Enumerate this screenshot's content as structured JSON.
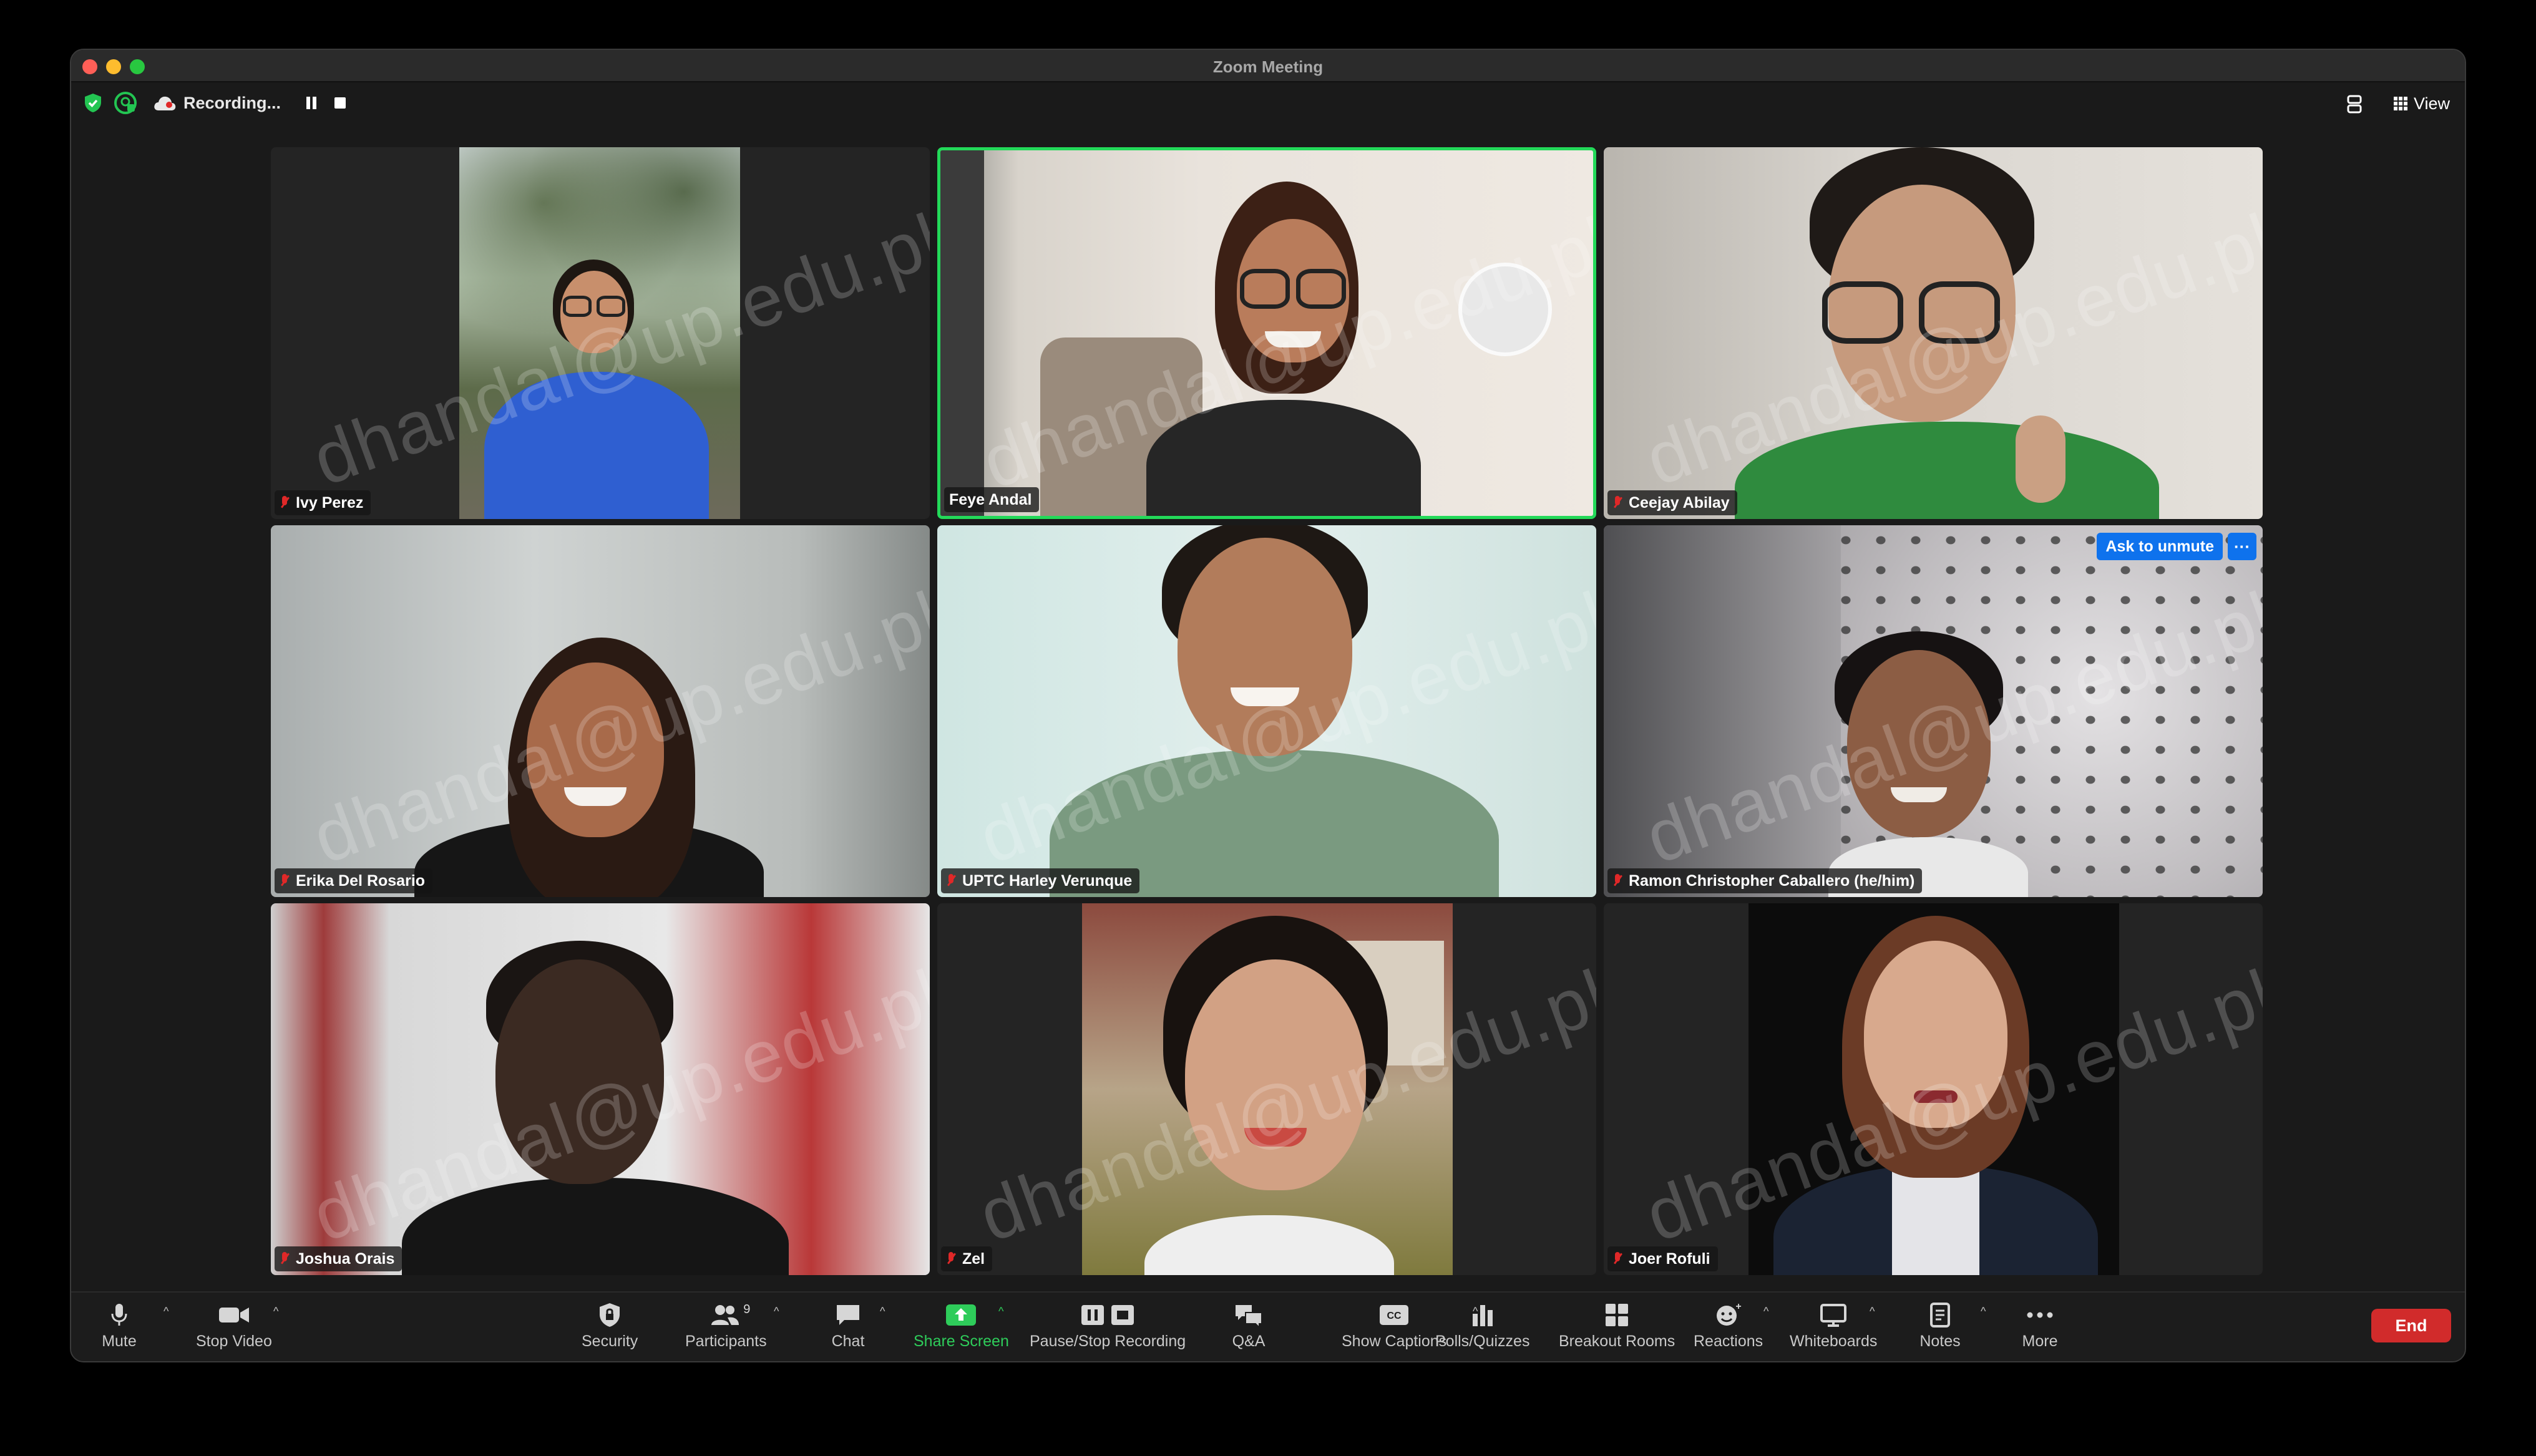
{
  "window": {
    "title": "Zoom Meeting"
  },
  "topbar": {
    "recording_label": "Recording...",
    "view_label": "View"
  },
  "participants": [
    {
      "name": "Ivy Perez",
      "muted": true
    },
    {
      "name": "Feye Andal",
      "muted": false,
      "active_speaker": true
    },
    {
      "name": "Ceejay Abilay",
      "muted": true
    },
    {
      "name": "Erika Del Rosario",
      "muted": true
    },
    {
      "name": "UPTC Harley Verunque",
      "muted": true
    },
    {
      "name": "Ramon Christopher Caballero (he/him)",
      "muted": true
    },
    {
      "name": "Joshua Orais",
      "muted": true
    },
    {
      "name": "Zel",
      "muted": true
    },
    {
      "name": "Joer Rofuli",
      "muted": true
    }
  ],
  "watermark": "dhandal@up.edu.ph",
  "tile_actions": {
    "ask_to_unmute": "Ask to unmute",
    "more": "···"
  },
  "toolbar": {
    "mute": "Mute",
    "stop_video": "Stop Video",
    "security": "Security",
    "participants": "Participants",
    "participants_count": "9",
    "chat": "Chat",
    "share_screen": "Share Screen",
    "pause_stop_recording": "Pause/Stop Recording",
    "qa": "Q&A",
    "show_captions": "Show Captions",
    "polls_quizzes": "Polls/Quizzes",
    "breakout_rooms": "Breakout Rooms",
    "reactions": "Reactions",
    "whiteboards": "Whiteboards",
    "notes": "Notes",
    "more": "More",
    "end": "End"
  },
  "colors": {
    "active_speaker": "#23d959",
    "ask_unmute": "#0e72ed",
    "end": "#d12b2b",
    "share_screen": "#2ecc5a"
  }
}
